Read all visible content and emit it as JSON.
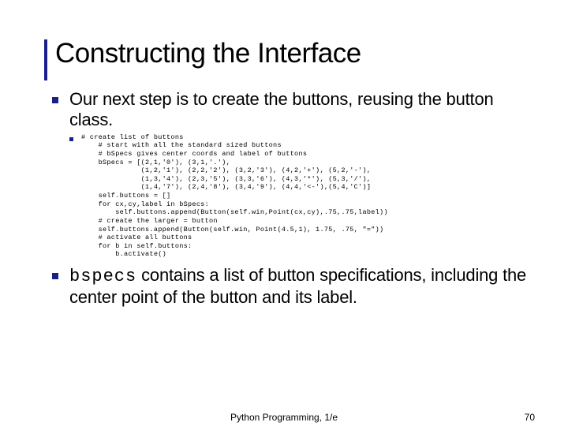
{
  "title": "Constructing the Interface",
  "point1": "Our next step is to create the buttons, reusing the button class.",
  "code": "# create list of buttons\n    # start with all the standard sized buttons\n    # bSpecs gives center coords and label of buttons\n    bSpecs = [(2,1,'0'), (3,1,'.'),\n              (1,2,'1'), (2,2,'2'), (3,2,'3'), (4,2,'+'), (5,2,'-'),\n              (1,3,'4'), (2,3,'5'), (3,3,'6'), (4,3,'*'), (5,3,'/'),\n              (1,4,'7'), (2,4,'8'), (3,4,'9'), (4,4,'<-'),(5,4,'C')]\n    self.buttons = []\n    for cx,cy,label in bSpecs:\n        self.buttons.append(Button(self.win,Point(cx,cy),.75,.75,label))\n    # create the larger = button\n    self.buttons.append(Button(self.win, Point(4.5,1), 1.75, .75, \"=\"))\n    # activate all buttons\n    for b in self.buttons:\n        b.activate()",
  "point2_mono": "bspecs",
  "point2_rest": " contains a list of button specifications, including the center point of the button and its label.",
  "footer_center": "Python Programming, 1/e",
  "footer_right": "70"
}
